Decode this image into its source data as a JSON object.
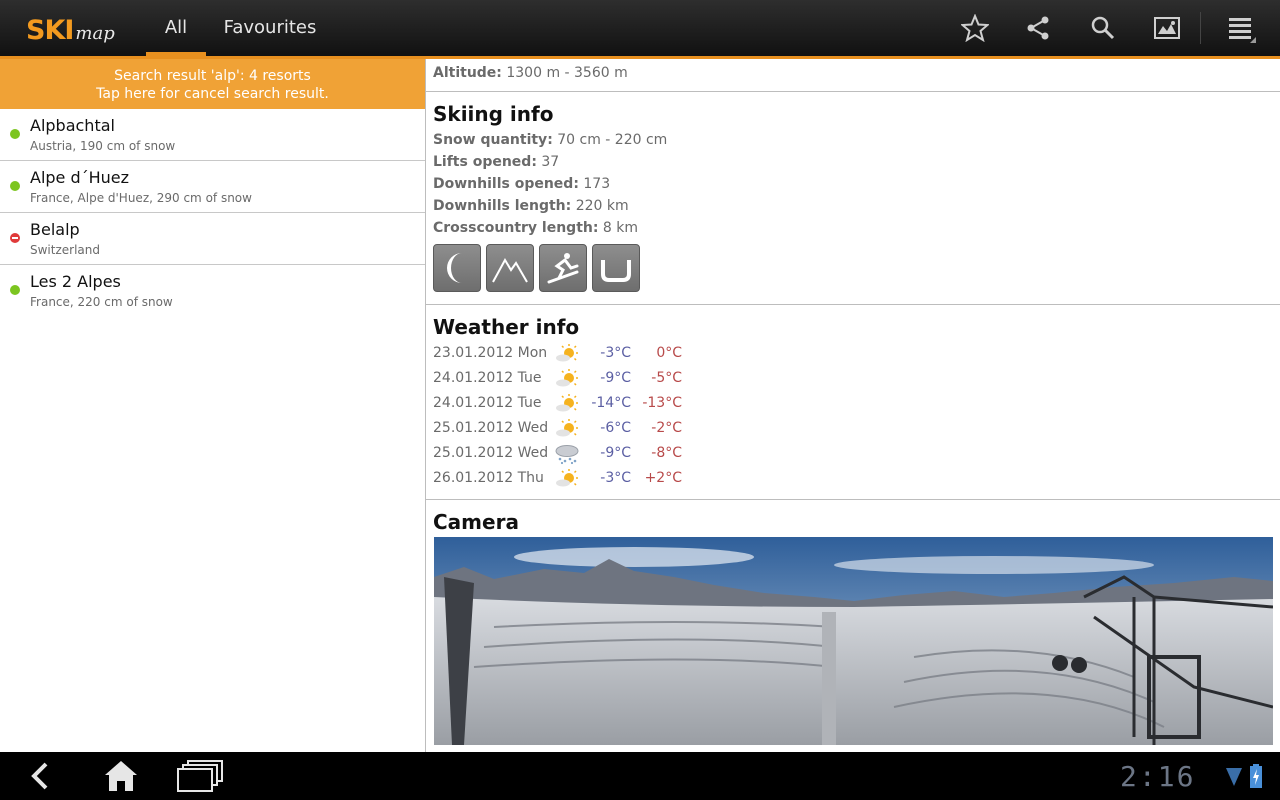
{
  "app": {
    "logo_ski": "SKI",
    "logo_map": "map",
    "tabs": [
      {
        "label": "All",
        "selected": true
      },
      {
        "label": "Favourites",
        "selected": false
      }
    ],
    "actions": [
      "star-icon",
      "share-icon",
      "search-icon",
      "map-icon",
      "menu-icon"
    ],
    "accent_color": "#e8901f"
  },
  "search": {
    "line1": "Search result 'alp': 4 resorts",
    "line2": "Tap here for cancel search result."
  },
  "resorts": [
    {
      "name": "Alpbachtal",
      "sub": "Austria, 190 cm of snow",
      "status": "open"
    },
    {
      "name": "Alpe d´Huez",
      "sub": "France, Alpe d'Huez, 290 cm of snow",
      "status": "open"
    },
    {
      "name": "Belalp",
      "sub": "Switzerland",
      "status": "closed"
    },
    {
      "name": "Les 2 Alpes",
      "sub": "France, 220 cm of snow",
      "status": "open"
    }
  ],
  "detail": {
    "altitude": {
      "label": "Altitude:",
      "value": "1300 m - 3560 m"
    },
    "skiing": {
      "title": "Skiing info",
      "snow": {
        "label": "Snow quantity:",
        "value": "70 cm - 220 cm"
      },
      "lifts": {
        "label": "Lifts opened:",
        "value": "37"
      },
      "downhills": {
        "label": "Downhills opened:",
        "value": "173"
      },
      "downhills_length": {
        "label": "Downhills length:",
        "value": "220 km"
      },
      "crosscountry": {
        "label": "Crosscountry length:",
        "value": "8 km"
      },
      "feature_icons": [
        "night-skiing-icon",
        "mountain-icon",
        "snowboard-icon",
        "halfpipe-icon"
      ]
    },
    "weather": {
      "title": "Weather info",
      "rows": [
        {
          "date": "23.01.2012 Mon",
          "icon": "sun-cloud-icon",
          "min": "-3°C",
          "max": "0°C"
        },
        {
          "date": "24.01.2012 Tue",
          "icon": "sun-cloud-icon",
          "min": "-9°C",
          "max": "-5°C"
        },
        {
          "date": "24.01.2012 Tue",
          "icon": "sun-cloud-icon",
          "min": "-14°C",
          "max": "-13°C"
        },
        {
          "date": "25.01.2012 Wed",
          "icon": "sun-cloud-icon",
          "min": "-6°C",
          "max": "-2°C"
        },
        {
          "date": "25.01.2012 Wed",
          "icon": "snow-cloud-icon",
          "min": "-9°C",
          "max": "-8°C"
        },
        {
          "date": "26.01.2012 Thu",
          "icon": "sun-cloud-icon",
          "min": "-3°C",
          "max": "+2°C"
        }
      ]
    },
    "camera": {
      "title": "Camera"
    }
  },
  "system": {
    "clock": "2:16"
  }
}
